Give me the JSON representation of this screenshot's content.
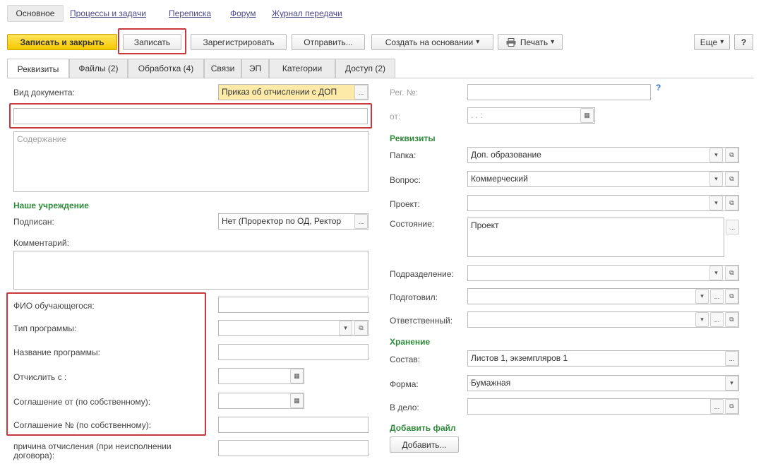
{
  "nav": {
    "main": "Основное",
    "processes": "Процессы и задачи",
    "correspondence": "Переписка",
    "forum": "Форум",
    "journal": "Журнал передачи"
  },
  "toolbar": {
    "save_close": "Записать и закрыть",
    "save": "Записать",
    "register": "Зарегистрировать",
    "send": "Отправить...",
    "create_based": "Создать на основании",
    "print": "Печать",
    "more": "Еще",
    "help": "?"
  },
  "tabs": [
    "Реквизиты",
    "Файлы (2)",
    "Обработка (4)",
    "Связи",
    "ЭП",
    "Категории",
    "Доступ (2)"
  ],
  "left": {
    "doc_type_label": "Вид документа:",
    "doc_type_value": "Приказ об отчислении с ДОП",
    "title_value": "",
    "content_placeholder": "Содержание",
    "section_institution": "Наше учреждение",
    "signed_label": "Подписан:",
    "signed_value": "Нет (Проректор по ОД, Ректор",
    "comment_label": "Комментарий:",
    "student_label": "ФИО обучающегося:",
    "program_type_label": "Тип программы:",
    "program_name_label": "Название программы:",
    "expel_from_label": "Отчислить с :",
    "agreement_date_label": "Соглашение от (по собственному):",
    "agreement_no_label": "Соглашение № (по собственному):",
    "reason_label": "причина отчисления (при неисполнении договора):"
  },
  "right": {
    "reg_no_label": "Рег. №:",
    "from_label": "от:",
    "date_placeholder": ".   .         :",
    "help_mark": "?",
    "section_requisites": "Реквизиты",
    "folder_label": "Папка:",
    "folder_value": "Доп. образование",
    "question_label": "Вопрос:",
    "question_value": "Коммерческий",
    "project_label": "Проект:",
    "project_value": "",
    "state_label": "Состояние:",
    "state_value": "Проект",
    "division_label": "Подразделение:",
    "prepared_label": "Подготовил:",
    "responsible_label": "Ответственный:",
    "section_storage": "Хранение",
    "composition_label": "Состав:",
    "composition_value": "Листов 1, экземпляров 1",
    "form_label": "Форма:",
    "form_value": "Бумажная",
    "to_case_label": "В дело:",
    "section_add_file": "Добавить файл",
    "add_button": "Добавить..."
  },
  "icons": {
    "dropdown": "▾",
    "open": "⧉",
    "ellipsis": "...",
    "calendar": "▦"
  },
  "colors": {
    "accent_yellow": "#f5c800",
    "section_green": "#2e8b3a",
    "highlight_red": "#c8393e",
    "field_yellow": "#fde9a8"
  }
}
